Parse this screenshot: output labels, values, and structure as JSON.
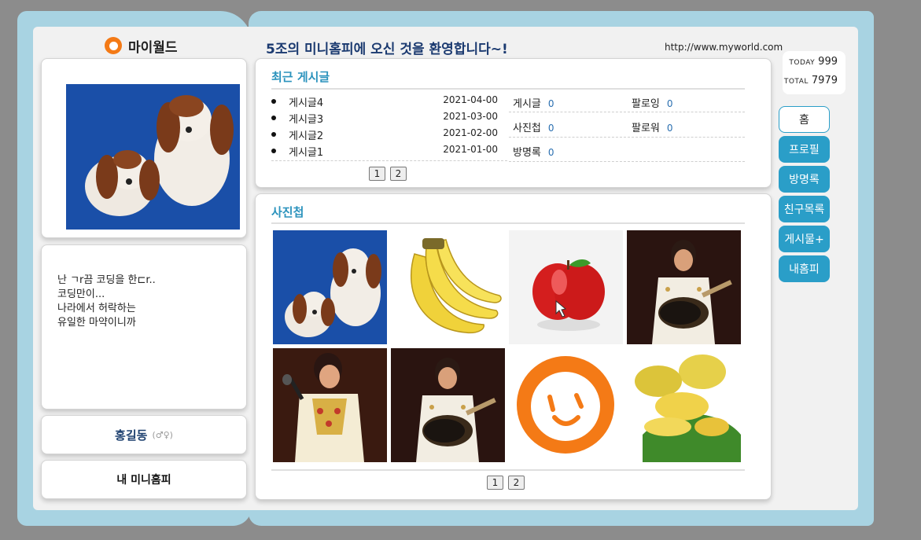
{
  "site": {
    "logo_text": "마이월드",
    "welcome": "5조의 미니홈피에 오신 것을 환영합니다~!",
    "url": "http://www.myworld.com"
  },
  "counter": {
    "today_label": "TODAY",
    "today_value": "999",
    "total_label": "TOTAL",
    "total_value": "7979"
  },
  "profile": {
    "bio": "난 ㄱr끔 코딩을 한⊏r..\n코딩만이...\n나라에서 허락하는\n유일한 마약이니까",
    "name": "홍길동",
    "gender": "(♂♀)",
    "my_home_label": "내 미니홈피"
  },
  "menu": [
    {
      "label": "홈",
      "active": true
    },
    {
      "label": "프로필",
      "active": false
    },
    {
      "label": "방명록",
      "active": false
    },
    {
      "label": "친구목록",
      "active": false
    },
    {
      "label": "게시물+",
      "active": false
    },
    {
      "label": "내홈피",
      "active": false
    }
  ],
  "recent": {
    "title": "최근 게시글",
    "posts": [
      {
        "title": "게시글4",
        "date": "2021-04-00"
      },
      {
        "title": "게시글3",
        "date": "2021-03-00"
      },
      {
        "title": "게시글2",
        "date": "2021-02-00"
      },
      {
        "title": "게시글1",
        "date": "2021-01-00"
      }
    ],
    "stats": [
      {
        "label": "게시글",
        "value": "0"
      },
      {
        "label": "팔로잉",
        "value": "0"
      },
      {
        "label": "사진첩",
        "value": "0"
      },
      {
        "label": "팔로워",
        "value": "0"
      },
      {
        "label": "방명록",
        "value": "0"
      }
    ],
    "pages": [
      "1",
      "2"
    ]
  },
  "gallery": {
    "title": "사진첩",
    "photos": [
      "puppies",
      "bananas",
      "apple",
      "singer-guitar",
      "singer-microphone",
      "singer-guitar",
      "orange-logo",
      "mangoes"
    ],
    "pages": [
      "1",
      "2"
    ]
  },
  "colors": {
    "frame": "#a8d3e2",
    "accent": "#2a9ec8",
    "title": "#2b93bd",
    "heading": "#1b3a70",
    "logo": "#f47a16"
  }
}
